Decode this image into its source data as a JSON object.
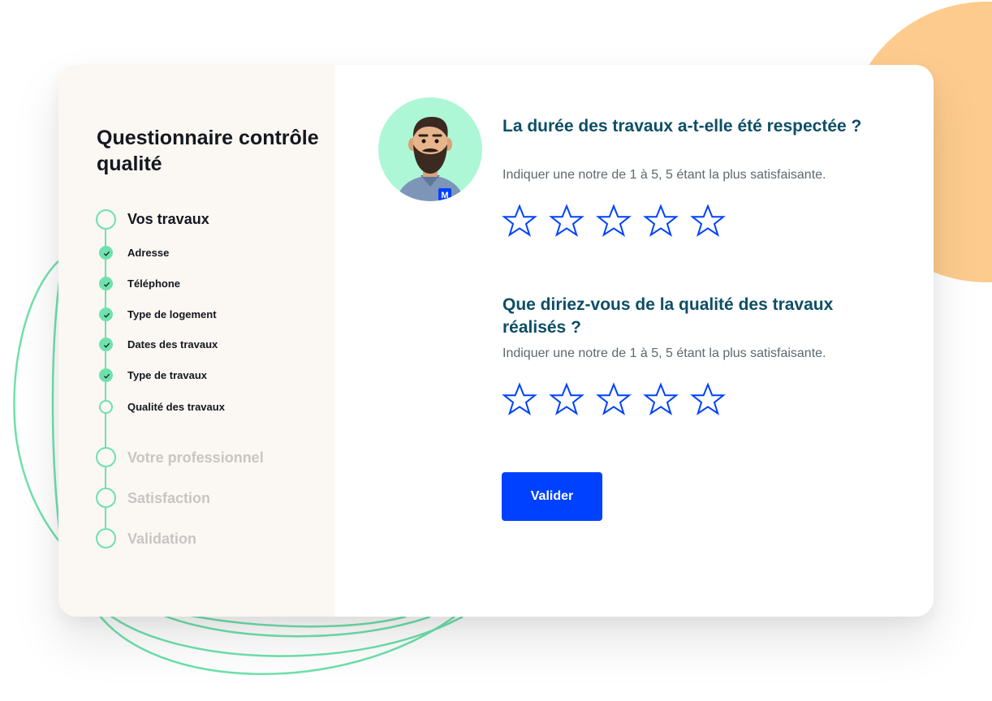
{
  "colors": {
    "accent_green": "#6ee1ad",
    "orange_blob": "#fdcb8d",
    "sidebar_bg": "#fbf7f3",
    "question_color": "#0d4e66",
    "button_blue": "#0041ff",
    "star_blue": "#0041ff",
    "avatar_bg": "#aef7d6"
  },
  "sidebar": {
    "title": "Questionnaire contrôle qualité",
    "steps": [
      {
        "label": "Vos travaux",
        "state": "active"
      },
      {
        "label": "Adresse",
        "state": "done"
      },
      {
        "label": "Téléphone",
        "state": "done"
      },
      {
        "label": "Type de logement",
        "state": "done"
      },
      {
        "label": "Dates des travaux",
        "state": "done"
      },
      {
        "label": "Type de travaux",
        "state": "done"
      },
      {
        "label": "Qualité des travaux",
        "state": "current"
      },
      {
        "label": "Votre professionnel",
        "state": "inactive"
      },
      {
        "label": "Satisfaction",
        "state": "inactive"
      },
      {
        "label": "Validation",
        "state": "inactive"
      }
    ]
  },
  "avatar": {
    "badge": "M"
  },
  "questions": [
    {
      "title": "La durée des travaux a-t-elle été respectée ?",
      "hint": "Indiquer une notre de 1 à 5, 5 étant la plus satisfaisante.",
      "rating": 0,
      "max_rating": 5
    },
    {
      "title": "Que diriez-vous de la qualité des travaux réalisés ?",
      "hint": "Indiquer une notre de 1 à 5, 5 étant la plus satisfaisante.",
      "rating": 0,
      "max_rating": 5
    }
  ],
  "submit": {
    "label": "Valider"
  }
}
